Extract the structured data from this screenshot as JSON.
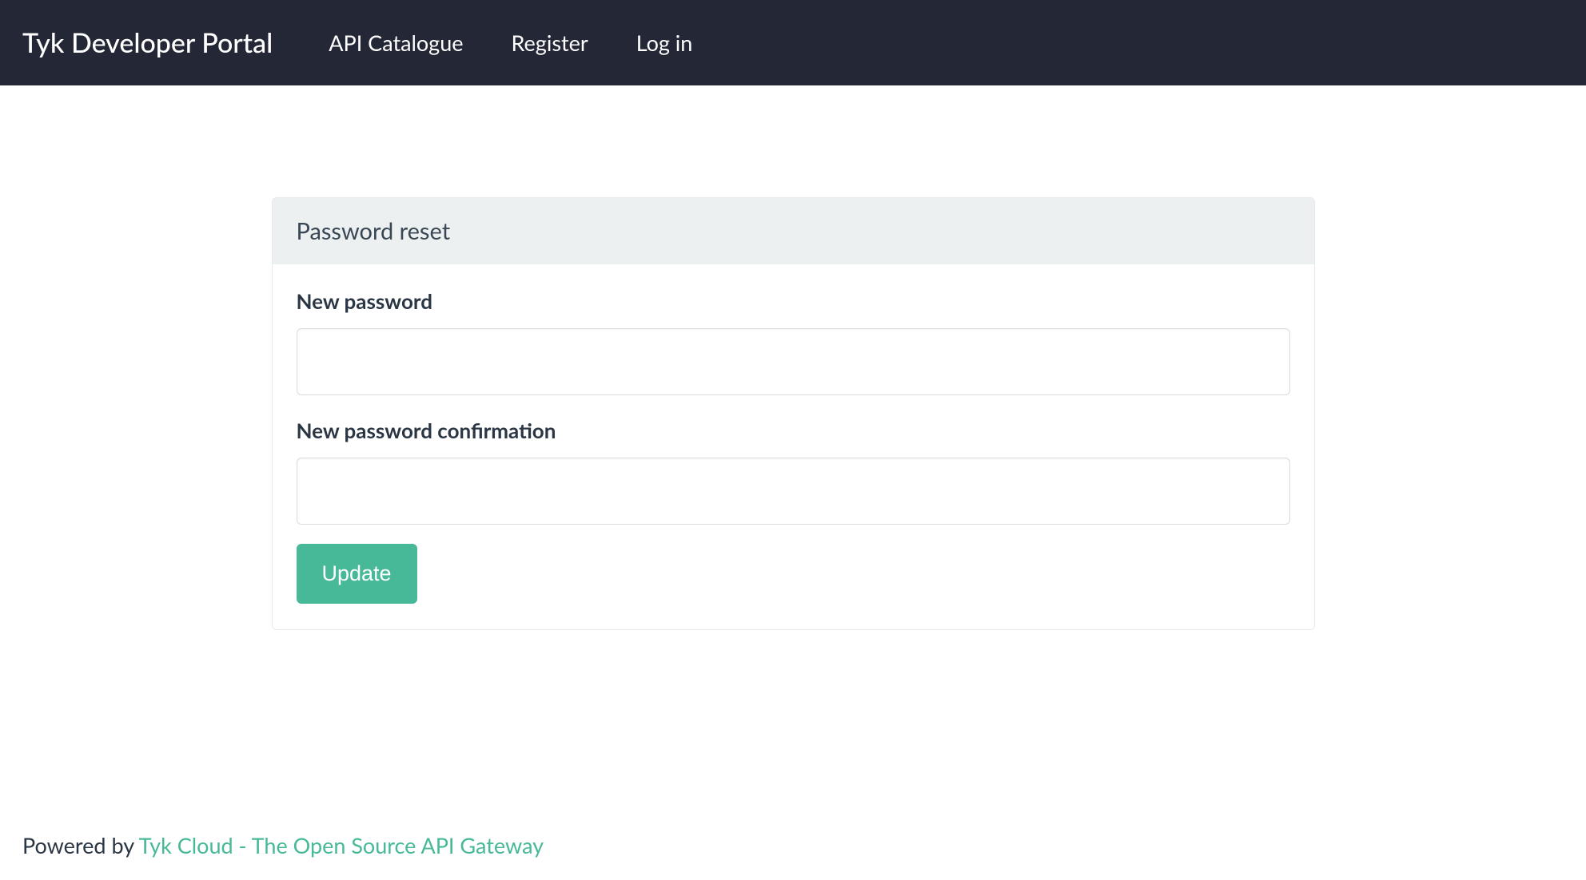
{
  "header": {
    "brand": "Tyk Developer Portal",
    "nav": {
      "catalogue": "API Catalogue",
      "register": "Register",
      "login": "Log in"
    }
  },
  "panel": {
    "title": "Password reset"
  },
  "form": {
    "new_password_label": "New password",
    "new_password_value": "",
    "confirm_label": "New password confirmation",
    "confirm_value": "",
    "submit_label": "Update"
  },
  "footer": {
    "prefix": "Powered by ",
    "link_text": "Tyk Cloud - The Open Source API Gateway"
  }
}
